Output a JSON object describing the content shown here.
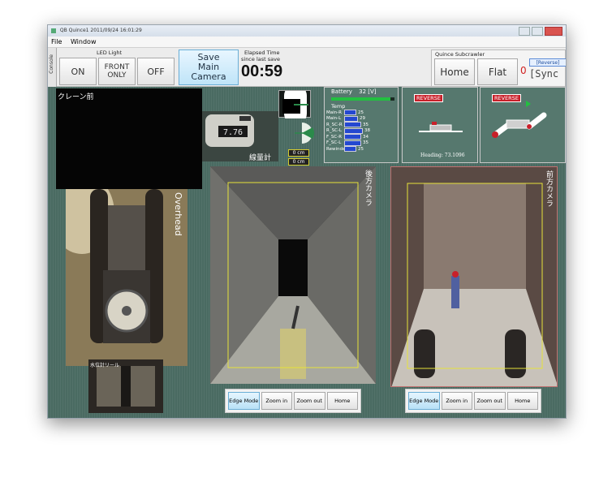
{
  "window": {
    "title": "QB Quince1 2011/09/24 16:01:29"
  },
  "menu": {
    "items": [
      "File",
      "Window"
    ]
  },
  "toolbar": {
    "console_tab": "Console",
    "led": {
      "label": "LED Light",
      "on": "ON",
      "front_only": "FRONT ONLY",
      "off": "OFF"
    },
    "save": {
      "line1": "Save",
      "line2": "Main Camera"
    },
    "elapsed": {
      "label1": "Elapsed Time",
      "label2": "since last save",
      "value": "00:59"
    },
    "subcrawler": {
      "label": "Quince Subcrawler",
      "home": "Home",
      "flat": "Flat",
      "value": "0",
      "reverse": "[Reverse]",
      "sync": "[Sync"
    }
  },
  "panels": {
    "crane": {
      "label": "クレーン前"
    },
    "gauge": {
      "label": "線量計"
    },
    "depth": {
      "top": "0 cm",
      "bottom": "0 cm"
    },
    "battery": {
      "label": "Battery",
      "value": "32 [V]",
      "level": 0.93,
      "temp_label": "Temp",
      "temps": [
        {
          "name": "Main-R",
          "value": "25"
        },
        {
          "name": "Main-L",
          "value": "29"
        },
        {
          "name": "R_SC-R",
          "value": "35"
        },
        {
          "name": "R_SC-L",
          "value": "38"
        },
        {
          "name": "F_SC-R",
          "value": "34"
        },
        {
          "name": "F_SC-L",
          "value": "35"
        },
        {
          "name": "Rewinder",
          "value": "25"
        }
      ]
    },
    "heading": {
      "reverse_badge": "REVERSE",
      "text": "Heading: 73.1096"
    },
    "pose": {
      "reverse_badge": "REVERSE"
    },
    "overhead": {
      "label": "Overhead"
    },
    "reel": {
      "label": "水位計リール"
    },
    "rear_camera": {
      "label": "後方カメラ",
      "controls": [
        "Edge Mode",
        "Zoom in",
        "Zoom out",
        "Home"
      ]
    },
    "front_camera": {
      "label": "前方カメラ",
      "controls": [
        "Edge Mode",
        "Zoom in",
        "Zoom out",
        "Home"
      ]
    }
  },
  "colors": {
    "panel_bg": "#4a6b62",
    "reverse_red": "#c8202a",
    "highlight_yellow": "#e6e23a",
    "battery_green": "#22c040",
    "temp_blue": "#2448d0"
  }
}
